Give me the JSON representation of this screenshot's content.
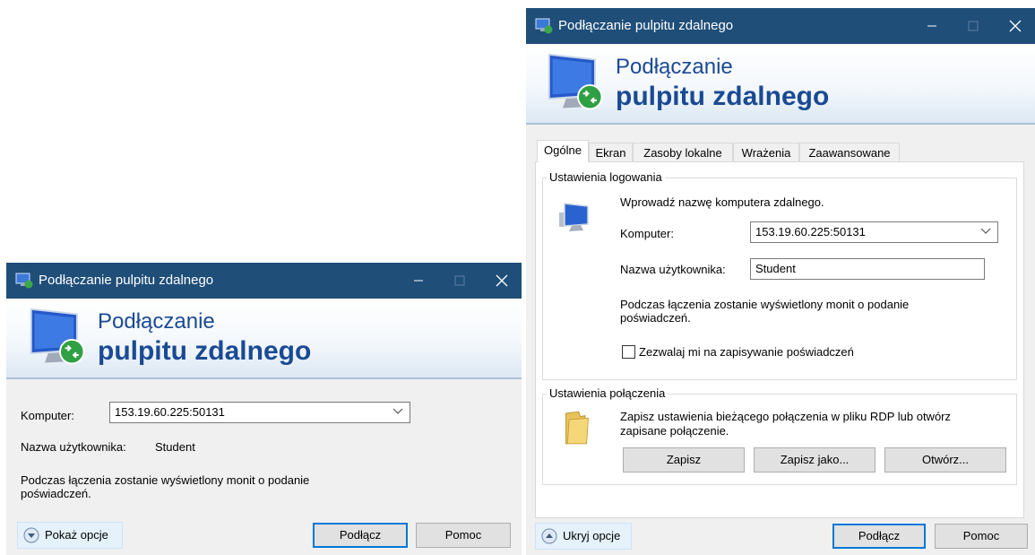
{
  "collapsed_window": {
    "title": "Podłączanie pulpitu zdalnego",
    "banner_line1": "Podłączanie",
    "banner_line2": "pulpitu zdalnego",
    "computer_label": "Komputer:",
    "computer_value": "153.19.60.225:50131",
    "user_label": "Nazwa użytkownika:",
    "user_value": "Student",
    "info_text_line1": "Podczas łączenia zostanie wyświetlony monit o podanie",
    "info_text_line2": "poświadczeń.",
    "show_options_label": "Pokaż opcje",
    "connect_label": "Podłącz",
    "help_label": "Pomoc"
  },
  "expanded_window": {
    "title": "Podłączanie pulpitu zdalnego",
    "banner_line1": "Podłączanie",
    "banner_line2": "pulpitu zdalnego",
    "tabs": [
      "Ogólne",
      "Ekran",
      "Zasoby lokalne",
      "Wrażenia",
      "Zaawansowane"
    ],
    "login_group": {
      "title": "Ustawienia logowania",
      "prompt": "Wprowadź nazwę komputera zdalnego.",
      "computer_label": "Komputer:",
      "computer_value": "153.19.60.225:50131",
      "user_label": "Nazwa użytkownika:",
      "user_value": "Student",
      "info_line1": "Podczas łączenia zostanie wyświetlony monit o podanie",
      "info_line2": "poświadczeń.",
      "save_credentials_label": "Zezwalaj mi na zapisywanie poświadczeń"
    },
    "connection_group": {
      "title": "Ustawienia połączenia",
      "text_line1": "Zapisz ustawienia bieżącego połączenia w pliku RDP lub otwórz",
      "text_line2": "zapisane połączenie.",
      "save_label": "Zapisz",
      "save_as_label": "Zapisz jako...",
      "open_label": "Otwórz..."
    },
    "hide_options_label": "Ukryj opcje",
    "connect_label": "Podłącz",
    "help_label": "Pomoc"
  },
  "icons": {
    "titlebar": "remote-desktop-icon",
    "banner": "remote-desktop-monitor-icon",
    "computer": "computer-icon",
    "folder": "folder-icon",
    "minimize": "minimize-icon",
    "maximize": "maximize-icon",
    "close": "close-icon"
  },
  "colors": {
    "titlebar": "#1f4e79",
    "banner_text": "#1a4a94",
    "default_button_border": "#0078d7",
    "dialog_background": "#f0f0f0"
  }
}
